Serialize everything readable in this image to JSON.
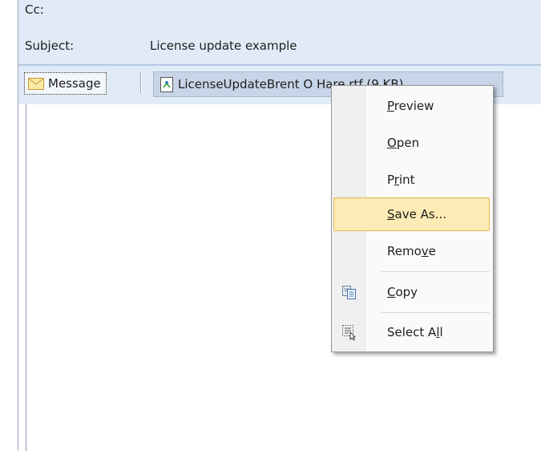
{
  "header": {
    "cc_label": "Cc:",
    "subject_label": "Subject:",
    "subject_value": "License update example"
  },
  "attachments": {
    "message_tab_label": "Message",
    "attachment_name": "LicenseUpdateBrent O Hare.rtf (9 KB)"
  },
  "context_menu": {
    "items": [
      {
        "label": "Preview",
        "access_key": "P",
        "rest": "review",
        "icon": ""
      },
      {
        "label": "Open",
        "access_key": "O",
        "rest": "pen",
        "icon": ""
      },
      {
        "label": "Print",
        "prefix": "P",
        "access_key": "r",
        "rest": "int",
        "icon": ""
      },
      {
        "label": "Save As...",
        "access_key": "S",
        "rest": "ave As...",
        "highlighted": true,
        "icon": ""
      },
      {
        "label": "Remove",
        "prefix": "Remo",
        "access_key": "v",
        "rest": "e",
        "icon": ""
      },
      {
        "label": "Copy",
        "access_key": "C",
        "rest": "opy",
        "icon": "copy-icon"
      },
      {
        "label": "Select All",
        "prefix": "Select A",
        "access_key": "l",
        "rest": "l",
        "icon": "select-all-icon"
      }
    ]
  },
  "colors": {
    "header_bg": "#e1ebf7",
    "menu_highlight": "#fcebb4",
    "menu_highlight_border": "#e9b84e"
  }
}
